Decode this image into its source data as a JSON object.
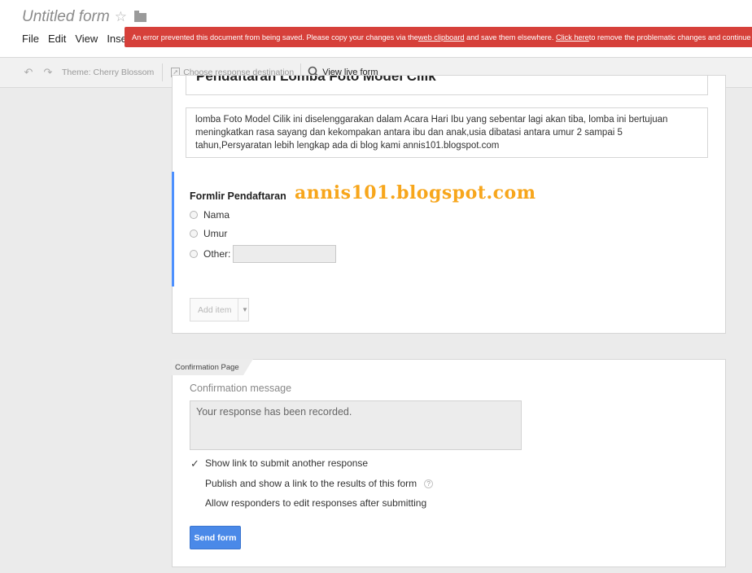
{
  "header": {
    "title": "Untitled form",
    "menu": [
      "File",
      "Edit",
      "View",
      "Inse"
    ]
  },
  "error_banner": {
    "text_before": "An error prevented this document from being saved. Please copy your changes via the ",
    "link1": "web clipboard",
    "text_middle": " and save them elsewhere. ",
    "link2": "Click here",
    "text_after": " to remove the problematic changes and continue"
  },
  "toolbar": {
    "theme_label": "Theme: Cherry Blossom",
    "response_label": "Choose response destination",
    "live_label": "View live form"
  },
  "form": {
    "title": "Pendaftaran Lomba Foto Model Cilik",
    "description": "lomba Foto Model Cilik ini diselenggarakan dalam Acara Hari Ibu yang sebentar lagi akan tiba, lomba ini bertujuan meningkatkan rasa sayang dan kekompakan antara ibu dan anak,usia dibatasi antara umur 2 sampai 5 tahun,Persyaratan lebih lengkap ada di blog kami annis101.blogspot.com",
    "question_title": "Formlir Pendaftaran",
    "options": [
      "Nama",
      "Umur"
    ],
    "other_label": "Other:",
    "add_item_label": "Add item"
  },
  "watermark": "annis101.blogspot.com",
  "confirmation": {
    "tab_label": "Confirmation Page",
    "message_label": "Confirmation message",
    "message_value": "Your response has been recorded.",
    "options": [
      {
        "label": "Show link to submit another response",
        "checked": true
      },
      {
        "label": "Publish and show a link to the results of this form",
        "checked": false
      },
      {
        "label": "Allow responders to edit responses after submitting",
        "checked": false
      }
    ],
    "send_label": "Send form"
  },
  "colors": {
    "error_banner": "#d6403a",
    "active_bar": "#4d90fe",
    "send_button": "#4a89e8",
    "watermark": "#f7a61c"
  }
}
